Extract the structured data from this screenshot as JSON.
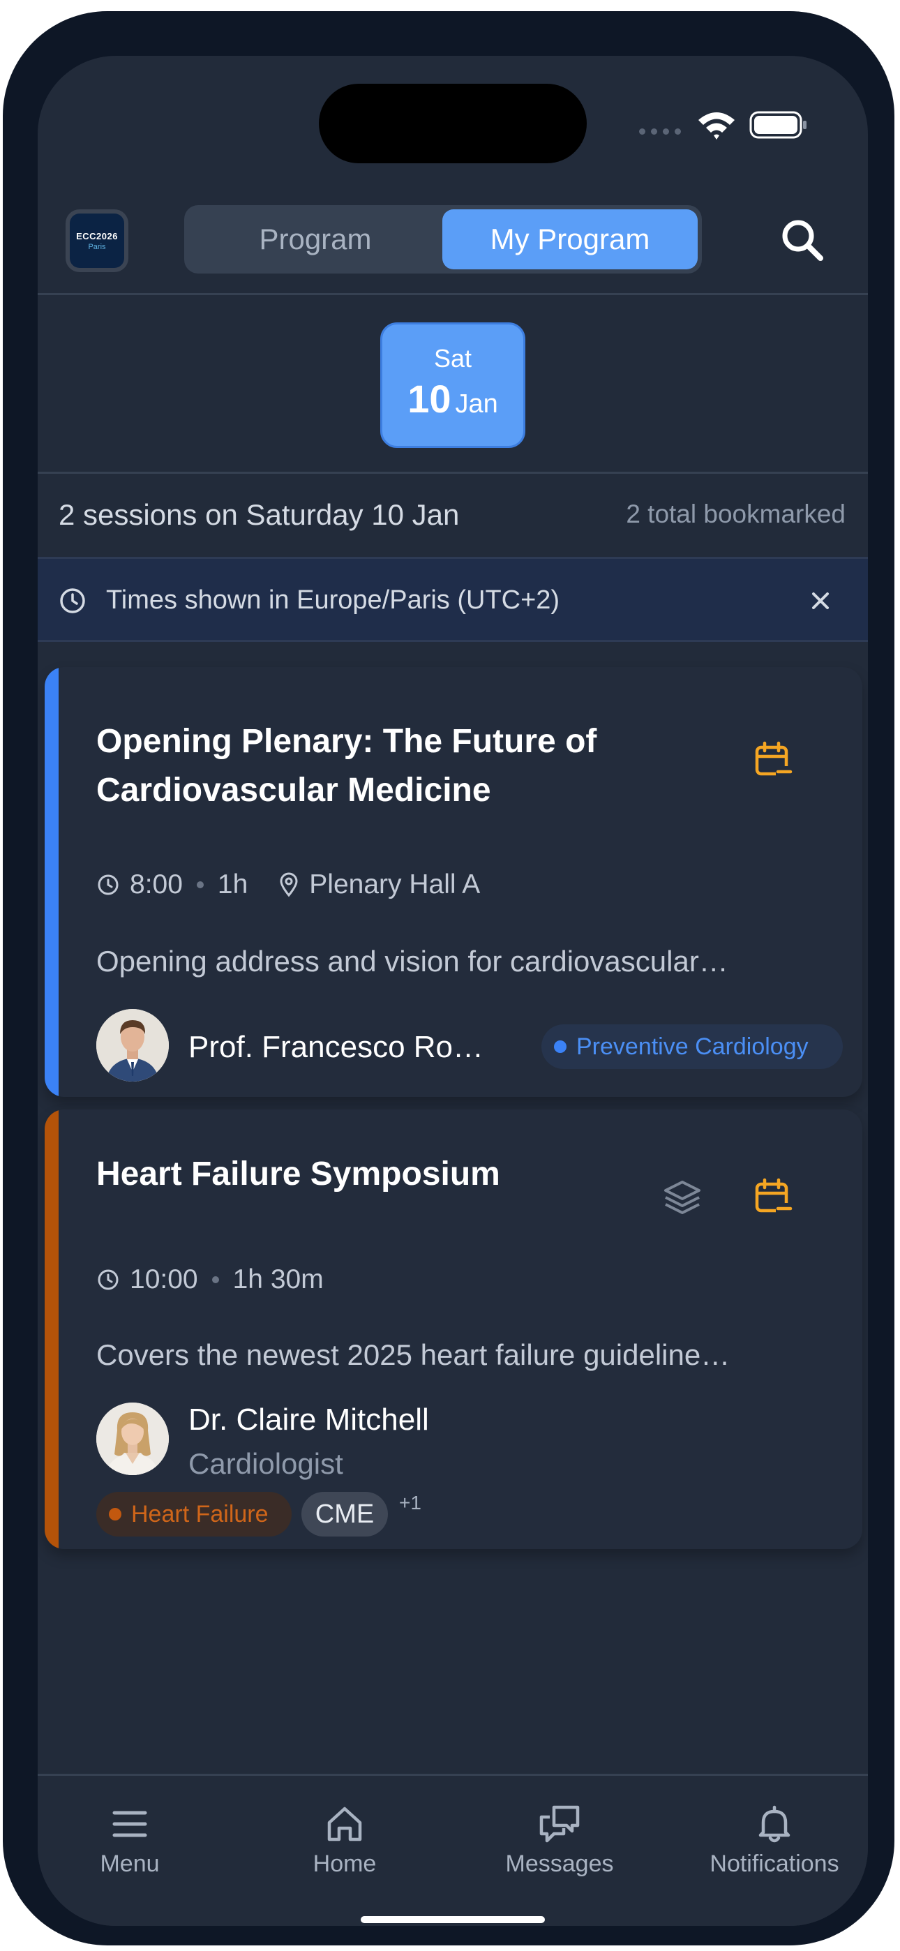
{
  "header": {
    "logo_line1": "ECC2026",
    "logo_line2": "Paris",
    "tabs": [
      {
        "label": "Program",
        "active": false
      },
      {
        "label": "My Program",
        "active": true
      }
    ]
  },
  "date": {
    "weekday": "Sat",
    "day": "10",
    "month": "Jan"
  },
  "summary": {
    "sessions_text": "2 sessions on Saturday 10 Jan",
    "bookmarked_text": "2 total bookmarked"
  },
  "timezone_notice": {
    "text": "Times shown in Europe/Paris (UTC+2)"
  },
  "sessions": [
    {
      "title_line1": "Opening Plenary: The Future of",
      "title_line2": "Cardiovascular Medicine",
      "time": "8:00",
      "duration": "1h",
      "location": "Plenary Hall A",
      "description": "Opening address and vision for cardiovascular…",
      "speaker": "Prof. Francesco Ro…",
      "tag": "Preventive Cardiology",
      "accent_color": "#3b82f6",
      "tag_color": "#3b82f6"
    },
    {
      "title": "Heart Failure Symposium",
      "time": "10:00",
      "duration": "1h 30m",
      "description": "Covers the newest 2025 heart failure guideline…",
      "speaker": "Dr. Claire Mitchell",
      "speaker_role": "Cardiologist",
      "tags": [
        "Heart Failure",
        "CME"
      ],
      "more_tags": "+1",
      "accent_color": "#b45309",
      "tag_color": "#c2580f"
    }
  ],
  "tabbar": [
    {
      "label": "Menu",
      "icon": "menu-icon"
    },
    {
      "label": "Home",
      "icon": "home-icon"
    },
    {
      "label": "Messages",
      "icon": "messages-icon"
    },
    {
      "label": "Notifications",
      "icon": "bell-icon"
    }
  ],
  "colors": {
    "background": "#222b3a",
    "primary": "#5b9ef7",
    "bookmark": "#f5a623"
  }
}
